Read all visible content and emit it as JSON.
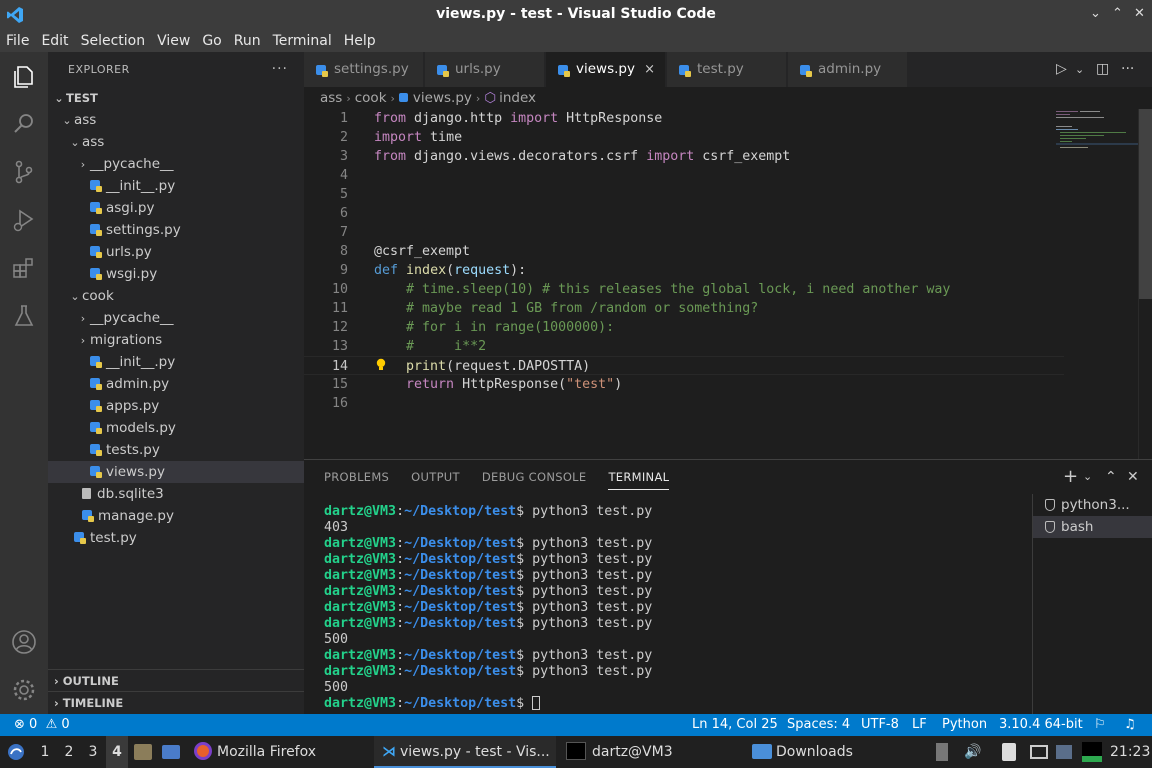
{
  "window": {
    "title": "views.py - test - Visual Studio Code",
    "controls": [
      "⌄",
      "⌃",
      "✕"
    ]
  },
  "menu": [
    "File",
    "Edit",
    "Selection",
    "View",
    "Go",
    "Run",
    "Terminal",
    "Help"
  ],
  "explorer": {
    "header": "EXPLORER",
    "more": "···",
    "root": "TEST",
    "items": [
      {
        "label": "ass",
        "type": "folder",
        "depth": 1,
        "expanded": true
      },
      {
        "label": "ass",
        "type": "folder",
        "depth": 2,
        "expanded": true
      },
      {
        "label": "__pycache__",
        "type": "folder",
        "depth": 3,
        "expanded": false
      },
      {
        "label": "__init__.py",
        "type": "py",
        "depth": 3
      },
      {
        "label": "asgi.py",
        "type": "py",
        "depth": 3
      },
      {
        "label": "settings.py",
        "type": "py",
        "depth": 3
      },
      {
        "label": "urls.py",
        "type": "py",
        "depth": 3
      },
      {
        "label": "wsgi.py",
        "type": "py",
        "depth": 3
      },
      {
        "label": "cook",
        "type": "folder",
        "depth": 2,
        "expanded": true
      },
      {
        "label": "__pycache__",
        "type": "folder",
        "depth": 3,
        "expanded": false
      },
      {
        "label": "migrations",
        "type": "folder",
        "depth": 3,
        "expanded": false
      },
      {
        "label": "__init__.py",
        "type": "py",
        "depth": 3
      },
      {
        "label": "admin.py",
        "type": "py",
        "depth": 3
      },
      {
        "label": "apps.py",
        "type": "py",
        "depth": 3
      },
      {
        "label": "models.py",
        "type": "py",
        "depth": 3
      },
      {
        "label": "tests.py",
        "type": "py",
        "depth": 3
      },
      {
        "label": "views.py",
        "type": "py",
        "depth": 3,
        "selected": true
      },
      {
        "label": "db.sqlite3",
        "type": "db",
        "depth": 2
      },
      {
        "label": "manage.py",
        "type": "py",
        "depth": 2
      },
      {
        "label": "test.py",
        "type": "py",
        "depth": 1
      }
    ],
    "outline": "OUTLINE",
    "timeline": "TIMELINE"
  },
  "tabs": [
    {
      "label": "settings.py",
      "active": false
    },
    {
      "label": "urls.py",
      "active": false
    },
    {
      "label": "views.py",
      "active": true,
      "close": "×"
    },
    {
      "label": "test.py",
      "active": false
    },
    {
      "label": "admin.py",
      "active": false
    }
  ],
  "editor_actions": [
    "▷",
    "⌄",
    "◫",
    "···"
  ],
  "breadcrumb": [
    "ass",
    "cook",
    "views.py",
    "index"
  ],
  "code": [
    {
      "n": "1",
      "tokens": [
        [
          "kw",
          "from"
        ],
        [
          "plain",
          " django.http "
        ],
        [
          "kw",
          "import"
        ],
        [
          "plain",
          " HttpResponse"
        ]
      ]
    },
    {
      "n": "2",
      "tokens": [
        [
          "kw",
          "import"
        ],
        [
          "plain",
          " time"
        ]
      ]
    },
    {
      "n": "3",
      "tokens": [
        [
          "kw",
          "from"
        ],
        [
          "plain",
          " django.views.decorators.csrf "
        ],
        [
          "kw",
          "import"
        ],
        [
          "plain",
          " csrf_exempt"
        ]
      ]
    },
    {
      "n": "4",
      "tokens": []
    },
    {
      "n": "5",
      "tokens": []
    },
    {
      "n": "6",
      "tokens": []
    },
    {
      "n": "7",
      "tokens": []
    },
    {
      "n": "8",
      "tokens": [
        [
          "plain",
          "@csrf_exempt"
        ]
      ]
    },
    {
      "n": "9",
      "tokens": [
        [
          "kwb",
          "def"
        ],
        [
          "plain",
          " "
        ],
        [
          "fn",
          "index"
        ],
        [
          "plain",
          "("
        ],
        [
          "var",
          "request"
        ],
        [
          "plain",
          "):"
        ]
      ]
    },
    {
      "n": "10",
      "tokens": [
        [
          "plain",
          "    "
        ],
        [
          "cm",
          "# time.sleep(10) # this releases the global lock, i need another way"
        ]
      ]
    },
    {
      "n": "11",
      "tokens": [
        [
          "plain",
          "    "
        ],
        [
          "cm",
          "# maybe read 1 GB from /random or something?"
        ]
      ]
    },
    {
      "n": "12",
      "tokens": [
        [
          "plain",
          "    "
        ],
        [
          "cm",
          "# for i in range(1000000):"
        ]
      ]
    },
    {
      "n": "13",
      "tokens": [
        [
          "plain",
          "    "
        ],
        [
          "cm",
          "#     i**2"
        ]
      ]
    },
    {
      "n": "14",
      "tokens": [
        [
          "plain",
          "    "
        ],
        [
          "fn",
          "print"
        ],
        [
          "plain",
          "(request.DAPOSTTA)"
        ]
      ],
      "current": true
    },
    {
      "n": "15",
      "tokens": [
        [
          "plain",
          "    "
        ],
        [
          "kw",
          "return"
        ],
        [
          "plain",
          " HttpResponse("
        ],
        [
          "str",
          "\"test\""
        ],
        [
          "plain",
          ")"
        ]
      ]
    },
    {
      "n": "16",
      "tokens": []
    }
  ],
  "panel": {
    "tabs": [
      "PROBLEMS",
      "OUTPUT",
      "DEBUG CONSOLE",
      "TERMINAL"
    ],
    "active_tab": "TERMINAL",
    "actions": [
      "+",
      "⌄",
      "⌃",
      "✕"
    ],
    "terminal_lines": [
      {
        "type": "prompt",
        "user": "dartz@VM3",
        "path": "~/Desktop/test",
        "cmd": "$ python3 test.py"
      },
      {
        "type": "out",
        "text": "403"
      },
      {
        "type": "prompt",
        "user": "dartz@VM3",
        "path": "~/Desktop/test",
        "cmd": "$ python3 test.py"
      },
      {
        "type": "prompt",
        "user": "dartz@VM3",
        "path": "~/Desktop/test",
        "cmd": "$ python3 test.py"
      },
      {
        "type": "prompt",
        "user": "dartz@VM3",
        "path": "~/Desktop/test",
        "cmd": "$ python3 test.py"
      },
      {
        "type": "prompt",
        "user": "dartz@VM3",
        "path": "~/Desktop/test",
        "cmd": "$ python3 test.py"
      },
      {
        "type": "prompt",
        "user": "dartz@VM3",
        "path": "~/Desktop/test",
        "cmd": "$ python3 test.py"
      },
      {
        "type": "prompt",
        "user": "dartz@VM3",
        "path": "~/Desktop/test",
        "cmd": "$ python3 test.py"
      },
      {
        "type": "out",
        "text": "500"
      },
      {
        "type": "prompt",
        "user": "dartz@VM3",
        "path": "~/Desktop/test",
        "cmd": "$ python3 test.py"
      },
      {
        "type": "prompt",
        "user": "dartz@VM3",
        "path": "~/Desktop/test",
        "cmd": "$ python3 test.py"
      },
      {
        "type": "out",
        "text": "500"
      },
      {
        "type": "prompt",
        "user": "dartz@VM3",
        "path": "~/Desktop/test",
        "cmd": "$ ",
        "cursor": true
      }
    ],
    "terminal_list": [
      {
        "label": "python3...",
        "active": false
      },
      {
        "label": "bash",
        "active": true
      }
    ]
  },
  "statusbar": {
    "errors": "0",
    "warnings": "0",
    "position": "Ln 14, Col 25",
    "spaces": "Spaces: 4",
    "encoding": "UTF-8",
    "eol": "LF",
    "language": "Python",
    "interpreter": "3.10.4 64-bit"
  },
  "taskbar": {
    "workspaces": [
      "1",
      "2",
      "3",
      "4"
    ],
    "active_workspace": "4",
    "apps": [
      {
        "label": "Mozilla Firefox",
        "active": false
      },
      {
        "label": "views.py - test - Vis...",
        "active": true
      },
      {
        "label": "dartz@VM3",
        "active": false
      },
      {
        "label": "Downloads",
        "active": false
      }
    ],
    "clock": "21:23"
  },
  "colors": {
    "accent": "#007acc",
    "editor_bg": "#1e1e1e",
    "sidebar_bg": "#252526",
    "activity_bg": "#333333",
    "terminal_user": "#23d18b",
    "terminal_path": "#3b8eea"
  }
}
